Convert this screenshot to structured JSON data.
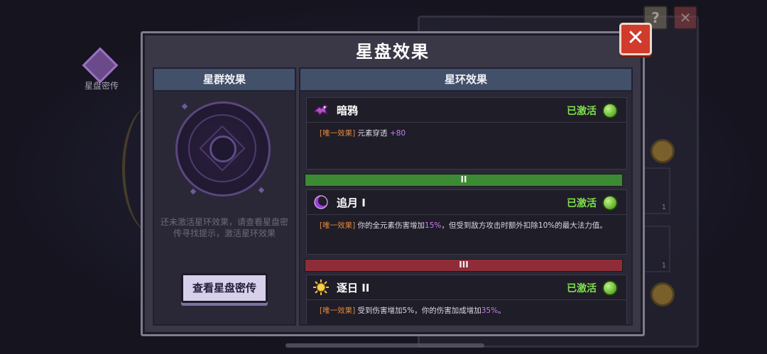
{
  "background": {
    "side_icon_label": "星盘密传",
    "help_symbol": "?",
    "close_symbol": "✕",
    "coin_symbol": "0",
    "slot_counts": [
      "1",
      "1"
    ]
  },
  "dialog": {
    "title": "星盘效果",
    "close_symbol": "✕",
    "left_panel": {
      "header": "星群效果",
      "hint": "还未激活星环效果，请查看星盘密传寻找提示，激活星环效果",
      "button": "查看星盘密传"
    },
    "right_panel": {
      "header": "星环效果",
      "effects": [
        {
          "name": "暗鸦",
          "icon": "raven-icon",
          "status": "已激活",
          "tag": "[唯一效果]",
          "desc_before": "元素穿透",
          "highlight": "+80",
          "desc_after": ""
        },
        {
          "divider": "II",
          "divider_color": "#3d8a34",
          "name": "追月 I",
          "icon": "crescent-moon-icon",
          "status": "已激活",
          "tag": "[唯一效果]",
          "desc_before": "你的全元素伤害增加",
          "highlight": "15%",
          "desc_after": "，但受到敌方攻击时额外扣除10%的最大法力值。"
        },
        {
          "divider": "III",
          "divider_color": "#8e2d38",
          "name": "逐日 II",
          "icon": "sun-icon",
          "status": "已激活",
          "tag": "[唯一效果]",
          "desc_before": "受到伤害增加5%，你的伤害加成增加",
          "highlight": "35%",
          "desc_after": "。"
        }
      ]
    }
  },
  "colors": {
    "active_green": "#7fe04a",
    "tag_orange": "#e58a3c",
    "highlight_purple": "#c77ef0",
    "close_red": "#d13b2c"
  }
}
